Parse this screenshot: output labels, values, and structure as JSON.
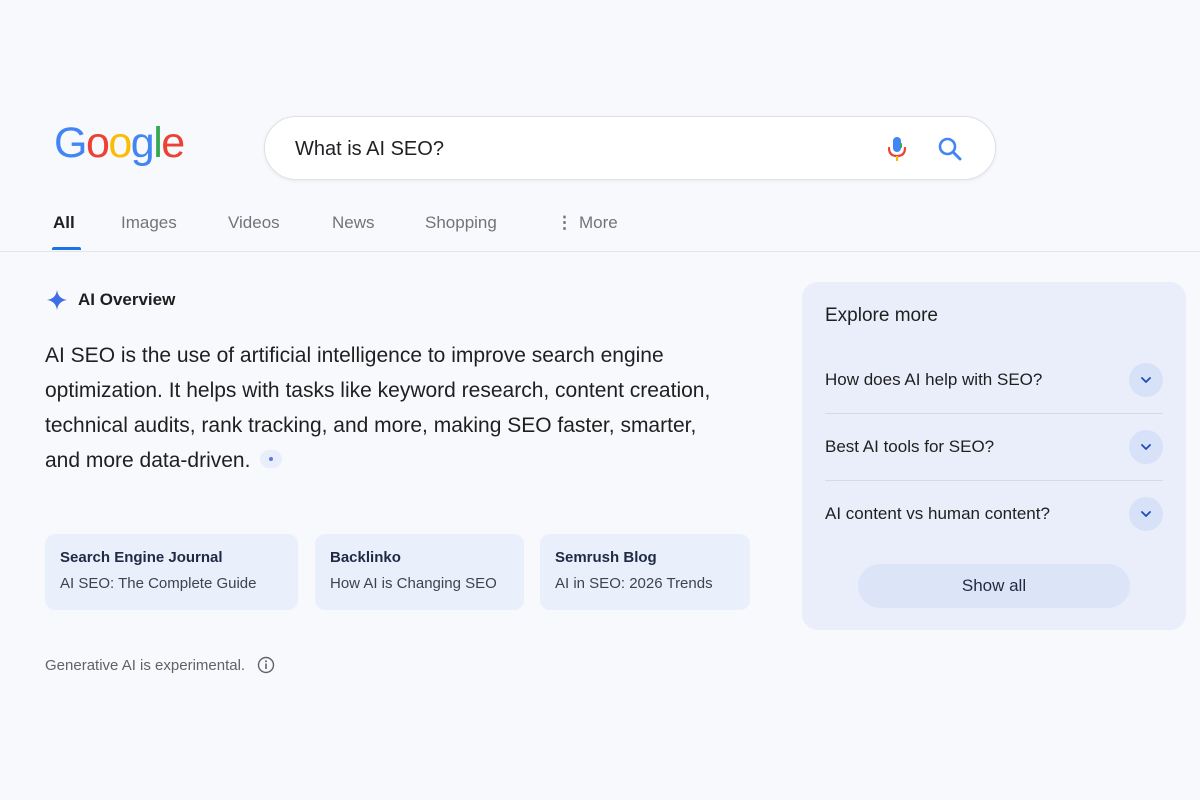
{
  "logo": {
    "letters": [
      "G",
      "o",
      "o",
      "g",
      "l",
      "e"
    ]
  },
  "search": {
    "query": "What is AI SEO?"
  },
  "tabs": [
    {
      "label": "All"
    },
    {
      "label": "Images"
    },
    {
      "label": "Videos"
    },
    {
      "label": "News"
    },
    {
      "label": "Shopping"
    },
    {
      "label": "More"
    }
  ],
  "ai_overview": {
    "title": "AI Overview",
    "body": "AI SEO is the use of artificial intelligence to improve search engine optimization. It helps with tasks like keyword research, content creation, technical audits, rank tracking, and more, making SEO faster, smarter, and more data-driven."
  },
  "sources": [
    {
      "name": "Search Engine Journal",
      "title": "AI SEO: The Complete Guide"
    },
    {
      "name": "Backlinko",
      "title": "How AI is Changing SEO"
    },
    {
      "name": "Semrush Blog",
      "title": "AI in SEO: 2026 Trends"
    }
  ],
  "disclaimer": "Generative AI is experimental.",
  "explore": {
    "title": "Explore more",
    "items": [
      {
        "label": "How does AI help with SEO?"
      },
      {
        "label": "Best AI tools for SEO?"
      },
      {
        "label": "AI content vs human content?"
      }
    ],
    "show_all": "Show all"
  },
  "colors": {
    "google_blue": "#4285F4",
    "google_red": "#EA4335",
    "google_yellow": "#FBBC05",
    "google_green": "#34A853",
    "accent": "#1a73e8"
  },
  "icons": {
    "mic": "mic-icon",
    "search": "search-icon",
    "spark": "spark-icon",
    "chevron": "chevron-down-icon",
    "info": "info-icon",
    "more": "more-vertical-icon"
  }
}
